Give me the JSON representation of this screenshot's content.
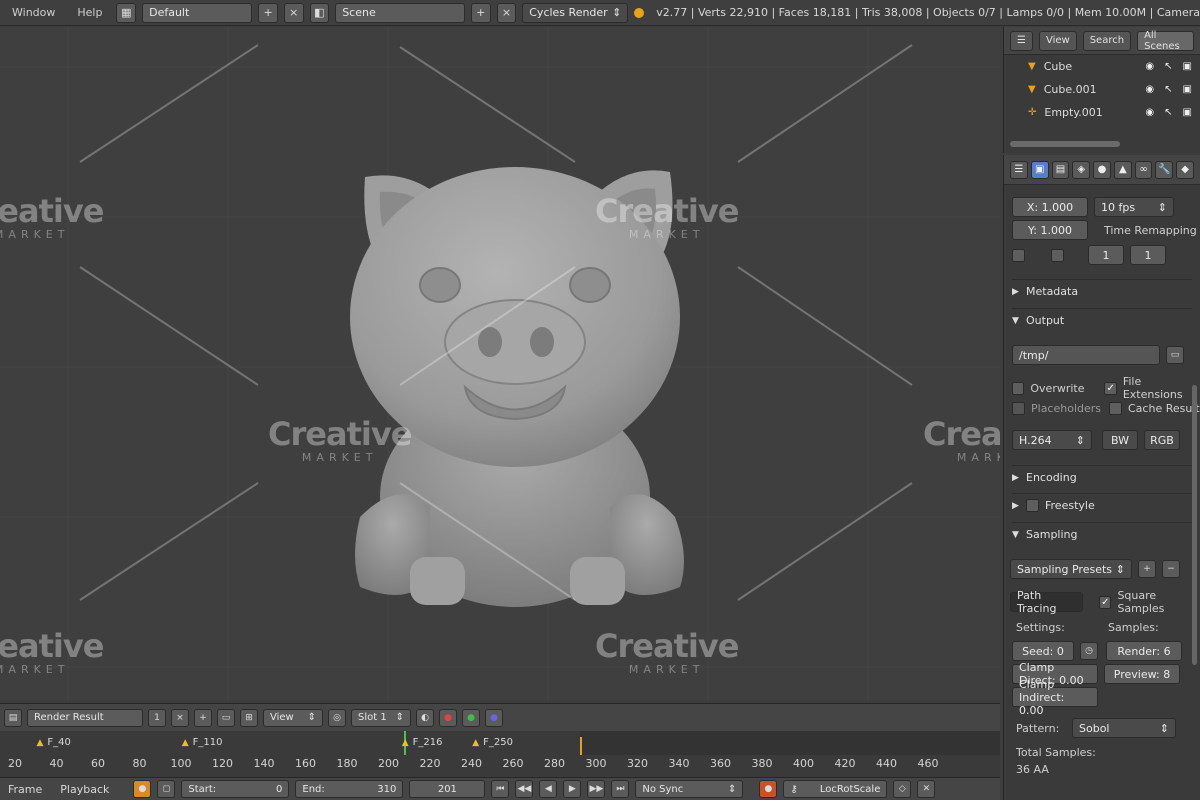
{
  "topbar": {
    "menus": [
      "Window",
      "Help"
    ],
    "layout_value": "Default",
    "scene_value": "Scene",
    "engine_value": "Cycles Render",
    "stats": "v2.77 | Verts 22,910 | Faces 18,181 | Tris 38,008 | Objects 0/7 | Lamps 0/0 | Mem 10.00M | Camera"
  },
  "outliner": {
    "tabs": [
      "View",
      "Search",
      "All Scenes"
    ],
    "items": [
      {
        "name": "Cube",
        "icon": "triangle-icon"
      },
      {
        "name": "Cube.001",
        "icon": "triangle-icon"
      },
      {
        "name": "Empty.001",
        "icon": "empty-icon"
      }
    ]
  },
  "properties": {
    "resolution_x": "X: 1.000",
    "resolution_y": "Y: 1.000",
    "fps": "10 fps",
    "time_remap_label": "Time Remapping",
    "time_remap_old": "1",
    "time_remap_new": "1",
    "sections": {
      "metadata": "Metadata",
      "output": "Output",
      "encoding": "Encoding",
      "freestyle": "Freestyle",
      "sampling": "Sampling"
    },
    "output_path": "/tmp/",
    "overwrite": "Overwrite",
    "file_extensions": "File Extensions",
    "placeholders": "Placeholders",
    "cache_result": "Cache Result",
    "format_value": "H.264",
    "bw": "BW",
    "rgb": "RGB",
    "sampling_presets": "Sampling Presets",
    "path_tracing": "Path Tracing",
    "square_samples": "Square Samples",
    "settings_label": "Settings:",
    "samples_label": "Samples:",
    "seed": "Seed: 0",
    "clamp_direct": "Clamp Direct: 0.00",
    "clamp_indirect": "Clamp Indirect: 0.00",
    "render_samples": "Render: 6",
    "preview_samples": "Preview: 8",
    "pattern_label": "Pattern:",
    "pattern_value": "Sobol",
    "total_samples_label": "Total Samples:",
    "total_samples_value": "36 AA"
  },
  "timeline": {
    "header_select": "Render Result",
    "header_slot": "1",
    "view_label": "View",
    "slot_label": "Slot 1",
    "markers": [
      {
        "label": "F_40",
        "frame": 40
      },
      {
        "label": "F_110",
        "frame": 110
      },
      {
        "label": "F_216",
        "frame": 216
      },
      {
        "label": "F_250",
        "frame": 250
      }
    ],
    "ticks": [
      20,
      40,
      60,
      80,
      100,
      120,
      140,
      160,
      180,
      200,
      220,
      240,
      260,
      280,
      300,
      320,
      340,
      360,
      380,
      400,
      420,
      440,
      460
    ],
    "current_frame": 200,
    "playbar": {
      "frame_label": "Frame",
      "playback_label": "Playback",
      "start": "Start:",
      "start_value": "0",
      "end": "End:",
      "end_value": "310",
      "current": "201",
      "sync": "No Sync",
      "keying": "LocRotScale"
    }
  },
  "colors": {
    "viewport_bg": "#3f3f3f",
    "panel_bg": "#3a3a3a",
    "accent_orange": "#e8a21a",
    "playhead_green": "#4cc24c",
    "active_tab_blue": "#5680c2"
  },
  "watermark": {
    "word": "Creative",
    "sub": "MARKET"
  }
}
